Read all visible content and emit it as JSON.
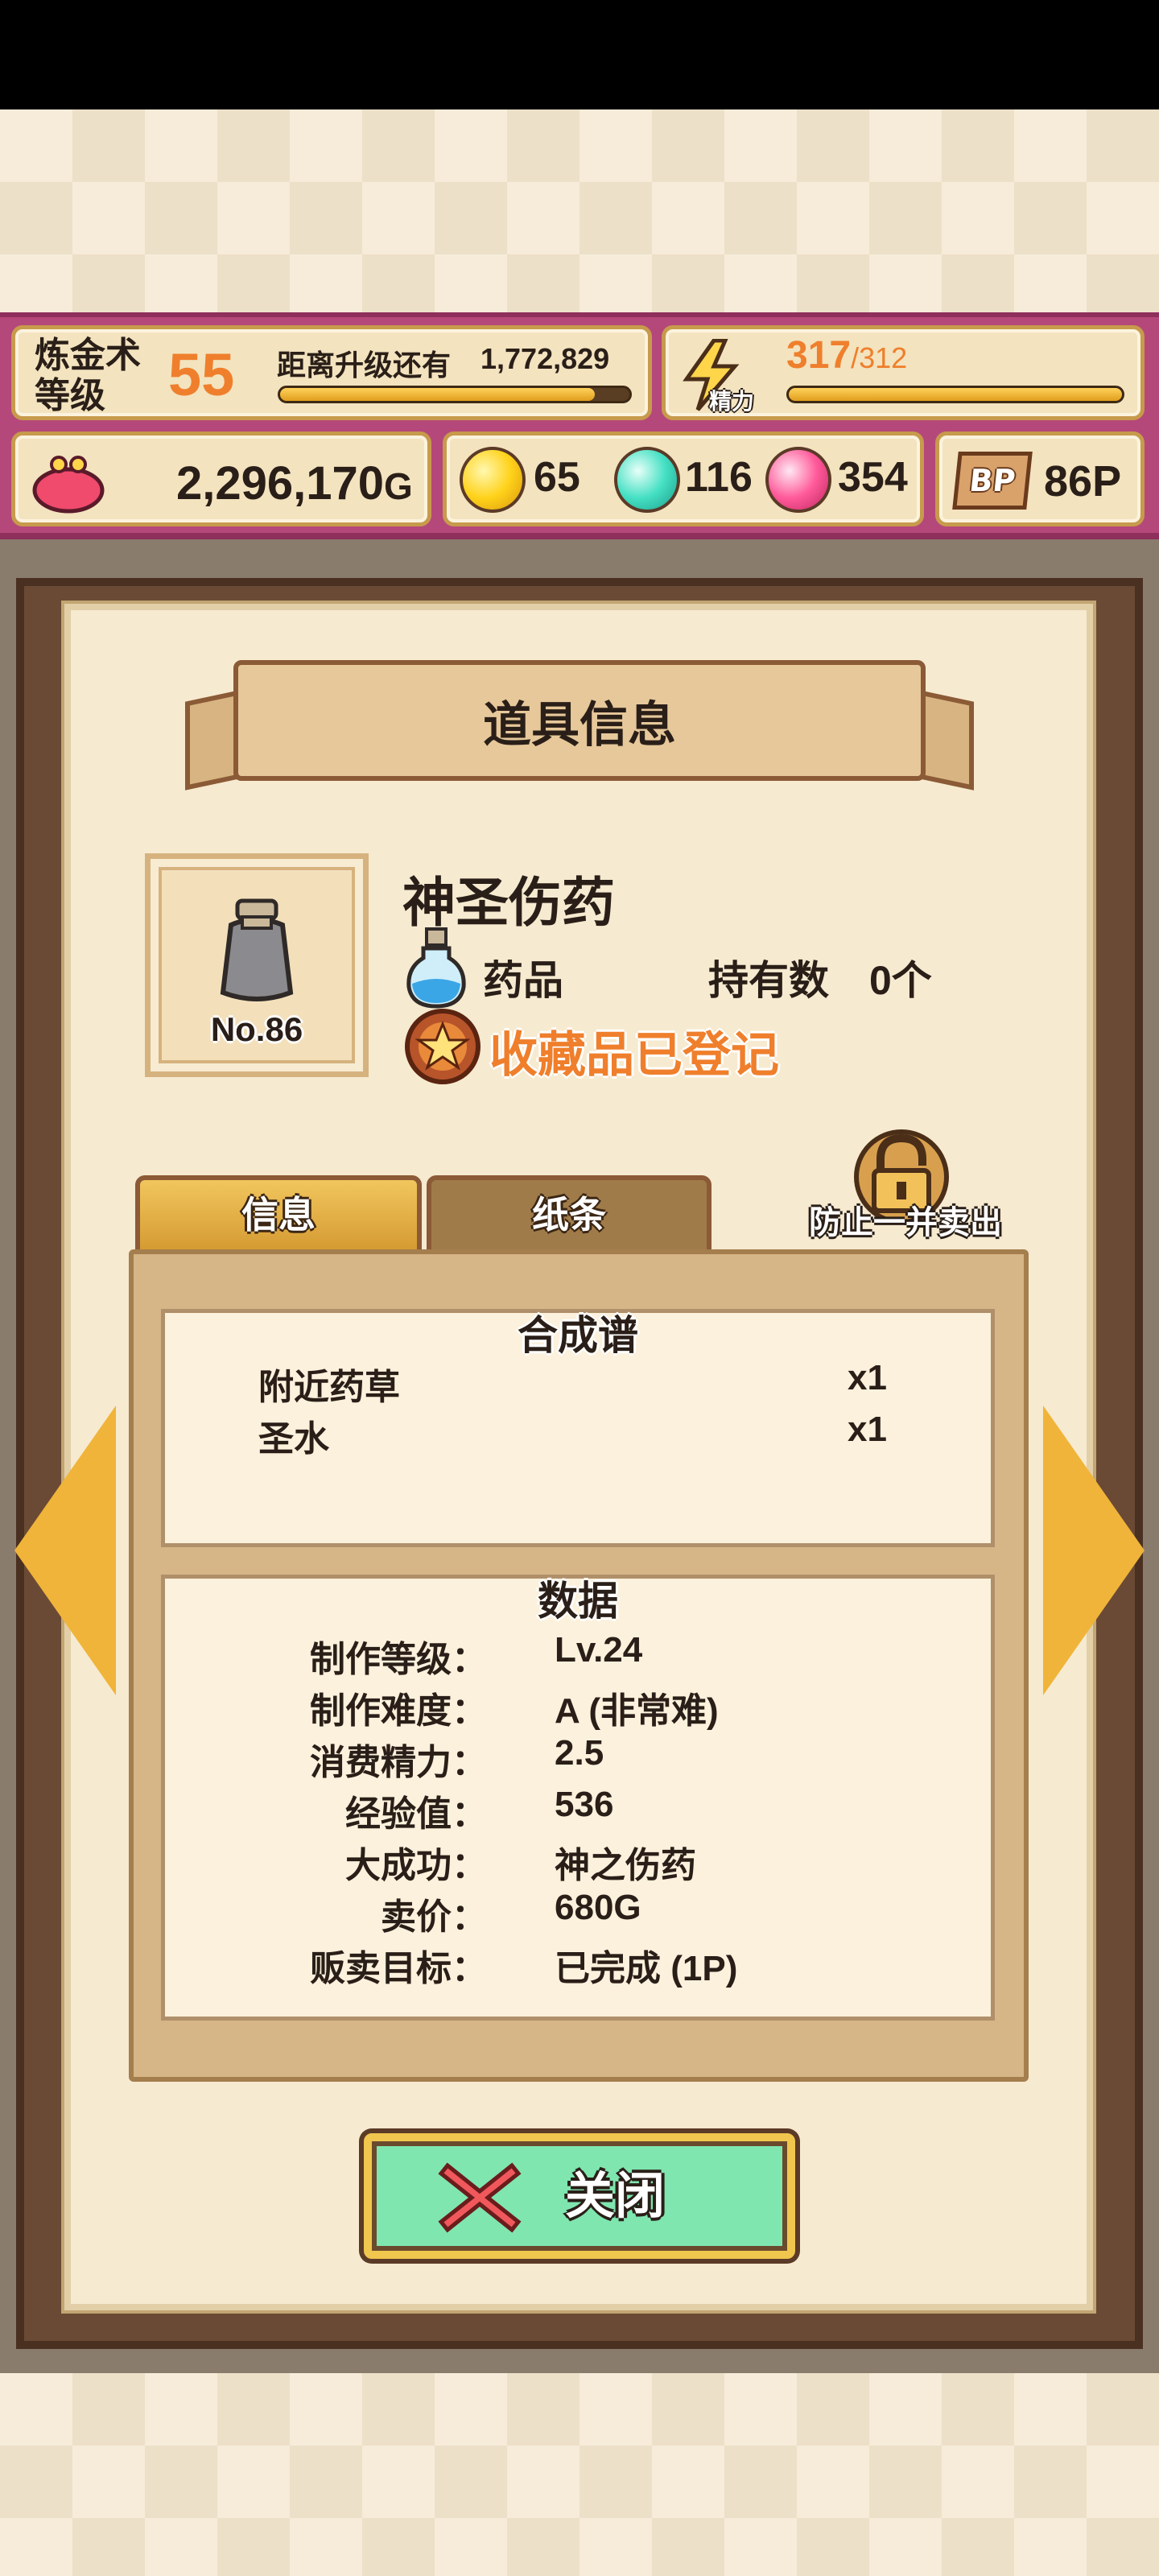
{
  "header": {
    "alchemy_label_line1": "炼金术",
    "alchemy_label_line2": "等级",
    "level": "55",
    "next_level_label": "距离升级还有",
    "exp_remaining": "1,772,829",
    "level_progress": 0.9,
    "energy_label": "精力",
    "energy_current": "317",
    "energy_max": "/312",
    "energy_progress": 1.0,
    "gold": "2,296,170",
    "gold_unit": "G",
    "yellow_gems": "65",
    "teal_gems": "116",
    "pink_gems": "354",
    "bp_icon_text": "BP",
    "bp_points": "86P"
  },
  "dialog": {
    "title": "道具信息",
    "item": {
      "number": "No.86",
      "name": "神圣伤药",
      "category": "药品",
      "owned_label": "持有数",
      "owned_value": "0个",
      "collection_status": "收藏品已登记"
    },
    "tabs": [
      {
        "label": "信息",
        "active": true
      },
      {
        "label": "纸条",
        "active": false
      }
    ],
    "lock_label": "防止一并卖出",
    "recipe": {
      "title": "合成谱",
      "ingredients": [
        {
          "name": "附近药草",
          "qty": "x1"
        },
        {
          "name": "圣水",
          "qty": "x1"
        }
      ]
    },
    "data": {
      "title": "数据",
      "rows": [
        {
          "label": "制作等级：",
          "value": "Lv.24"
        },
        {
          "label": "制作难度：",
          "value": "A (非常难)"
        },
        {
          "label": "消费精力：",
          "value": "2.5"
        },
        {
          "label": "经验值：",
          "value": "536"
        },
        {
          "label": "大成功：",
          "value": "神之伤药"
        },
        {
          "label": "卖价：",
          "value": "680G"
        },
        {
          "label": "贩卖目标：",
          "value": "已完成 (1P)"
        }
      ]
    },
    "close_label": "关闭"
  },
  "colors": {
    "hud_bar": "#b5487a",
    "accent_orange": "#ef7f2c",
    "panel": "#f6ead0",
    "close_button": "#7fe6b0",
    "arrow": "#f0b43a"
  }
}
